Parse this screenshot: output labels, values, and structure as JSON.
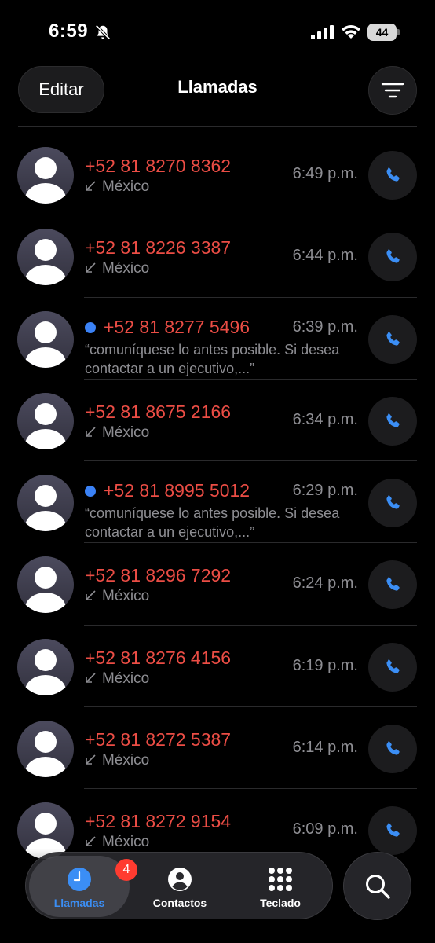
{
  "status": {
    "time": "6:59",
    "battery": "44"
  },
  "header": {
    "edit_label": "Editar",
    "title": "Llamadas"
  },
  "calls": [
    {
      "number": "+52 81 8270 8362",
      "sub": "México",
      "time": "6:49 p.m.",
      "unread": false
    },
    {
      "number": "+52 81 8226 3387",
      "sub": "México",
      "time": "6:44 p.m.",
      "unread": false
    },
    {
      "number": "+52 81 8277 5496",
      "sub": "“comuníquese lo antes posible. Si desea contactar a un ejecutivo,...”",
      "time": "6:39 p.m.",
      "unread": true
    },
    {
      "number": "+52 81 8675 2166",
      "sub": "México",
      "time": "6:34 p.m.",
      "unread": false
    },
    {
      "number": "+52 81 8995 5012",
      "sub": "“comuníquese lo antes posible. Si desea contactar a un ejecutivo,...”",
      "time": "6:29 p.m.",
      "unread": true
    },
    {
      "number": "+52 81 8296 7292",
      "sub": "México",
      "time": "6:24 p.m.",
      "unread": false
    },
    {
      "number": "+52 81 8276 4156",
      "sub": "México",
      "time": "6:19 p.m.",
      "unread": false
    },
    {
      "number": "+52 81 8272 5387",
      "sub": "México",
      "time": "6:14 p.m.",
      "unread": false
    },
    {
      "number": "+52 81 8272 9154",
      "sub": "México",
      "time": "6:09 p.m.",
      "unread": false
    }
  ],
  "tabs": {
    "calls_label": "Llamadas",
    "calls_badge": "4",
    "contacts_label": "Contactos",
    "keypad_label": "Teclado"
  },
  "colors": {
    "missed": "#eb4d45",
    "accent": "#3b8ef5",
    "unread_dot": "#3b82f6",
    "badge": "#ff3b30"
  },
  "icons": {
    "filter": "filter-icon",
    "call": "phone-icon",
    "search": "search-icon",
    "recents": "clock-icon",
    "contacts": "person-circle-icon",
    "keypad": "keypad-grid-icon",
    "incoming": "incoming-arrow-icon"
  }
}
